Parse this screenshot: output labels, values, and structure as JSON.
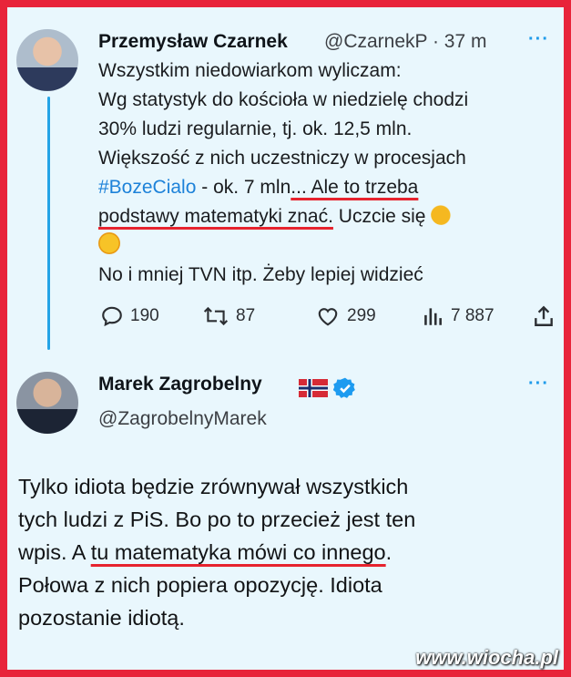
{
  "tweet1": {
    "author": "Przemysław Czarnek",
    "handle_time": "@CzarnekP · 37 m",
    "more": "···",
    "lines": [
      "Wszystkim niedowiarkom wyliczam:",
      "Wg statystyk do kościoła w niedzielę chodzi",
      "30% ludzi regularnie, tj. ok. 12,5 mln.",
      "Większość z nich uczestniczy w procesjach"
    ],
    "hashtag": "#BozeCialo",
    "line5_rest": " - ok. 7 mln",
    "line5_underlined": "... Ale to trzeba",
    "line6_underlined": "podstawy matematyki znać.",
    "line6_rest": " Uczcie się",
    "line8": "No i mniej TVN itp. Żeby lepiej widzieć",
    "stats": {
      "replies": "190",
      "retweets": "87",
      "likes": "299",
      "views": "7 887"
    }
  },
  "tweet2": {
    "author": "Marek Zagrobelny",
    "handle": "@ZagrobelnyMarek",
    "more": "···",
    "line1": "Tylko idiota będzie zrównywał wszystkich",
    "line2": "tych ludzi z PiS. Bo po to przecież jest ten",
    "line3_pre": "wpis. A ",
    "line3_underlined": "tu matematyka mówi co innego",
    "line3_post": ".",
    "line4": "Połowa z nich popiera opozycję. Idiota",
    "line5": "pozostanie idiotą."
  },
  "watermark": "www.wiocha.pl",
  "colors": {
    "frame": "#e8243a",
    "background": "#e9f7fd",
    "link": "#1d82d9",
    "thread_line": "#24a4e6",
    "underline": "#e6232e"
  }
}
